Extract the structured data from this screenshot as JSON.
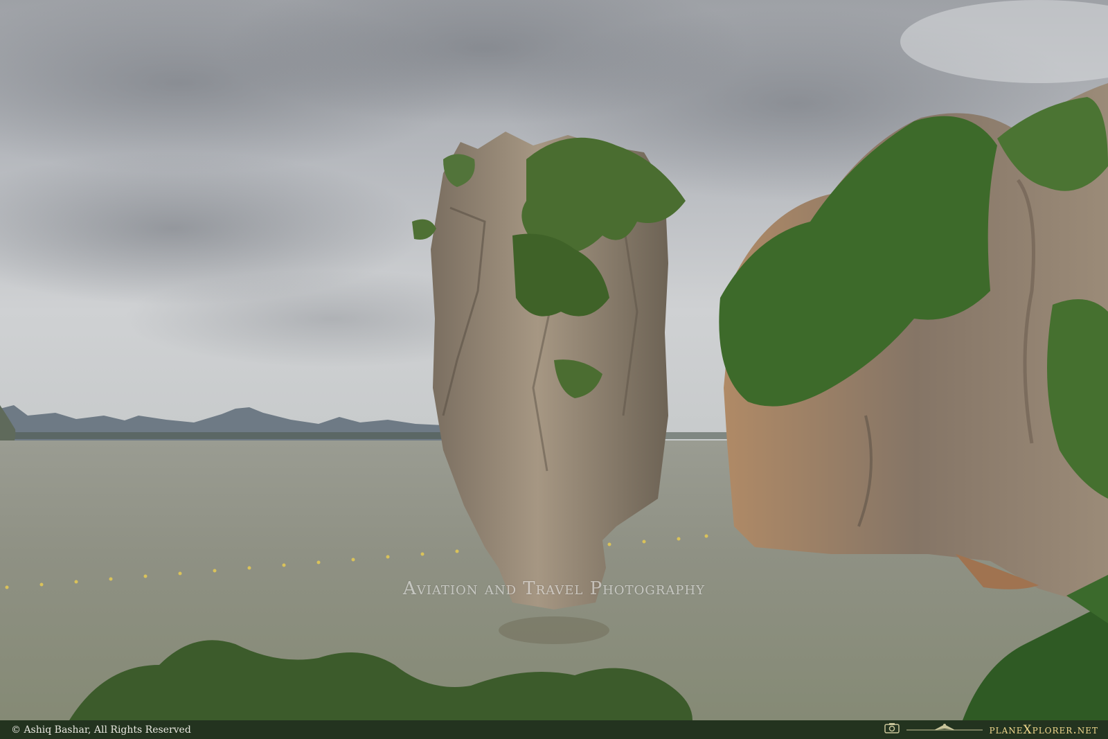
{
  "photo": {
    "subject": "Limestone sea stack rising from calm bay beside a vegetated karst cliff under overcast sky",
    "watermark_text": "Aviation and Travel Photography",
    "colors": {
      "sky": "#b9bcc0",
      "water": "#8d8f7f",
      "rock": "#9a8c78",
      "foliage": "#3f6a2c",
      "footer": "#23331f"
    }
  },
  "footer": {
    "copyright": "© Ashiq Bashar, All Rights Reserved",
    "brand": "planeXplorer.net",
    "camera_icon": "camera-icon",
    "plane_icon": "airplane-icon"
  }
}
